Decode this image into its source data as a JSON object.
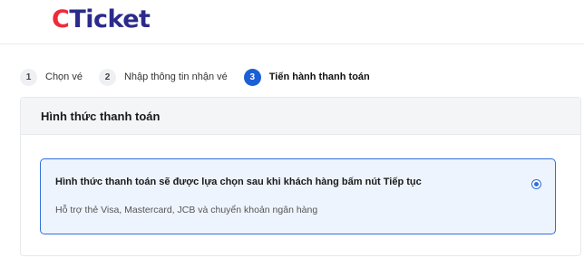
{
  "brand": {
    "logo_first": "C",
    "logo_rest": "Ticket",
    "primary": "#2b2a8c",
    "accent": "#ee2a3b"
  },
  "stepper": {
    "steps": [
      {
        "number": "1",
        "label": "Chọn vé",
        "active": false
      },
      {
        "number": "2",
        "label": "Nhập thông tin nhận vé",
        "active": false
      },
      {
        "number": "3",
        "label": "Tiến hành thanh toán",
        "active": true
      }
    ],
    "active_color": "#1b5fd6"
  },
  "payment": {
    "title": "Hình thức thanh toán",
    "option": {
      "title": "Hình thức thanh toán sẽ được lựa chọn sau khi khách hàng bấm nút Tiếp tục",
      "subtitle": "Hỗ trợ thẻ Visa, Mastercard, JCB và chuyển khoản ngân hàng",
      "selected": true
    }
  }
}
